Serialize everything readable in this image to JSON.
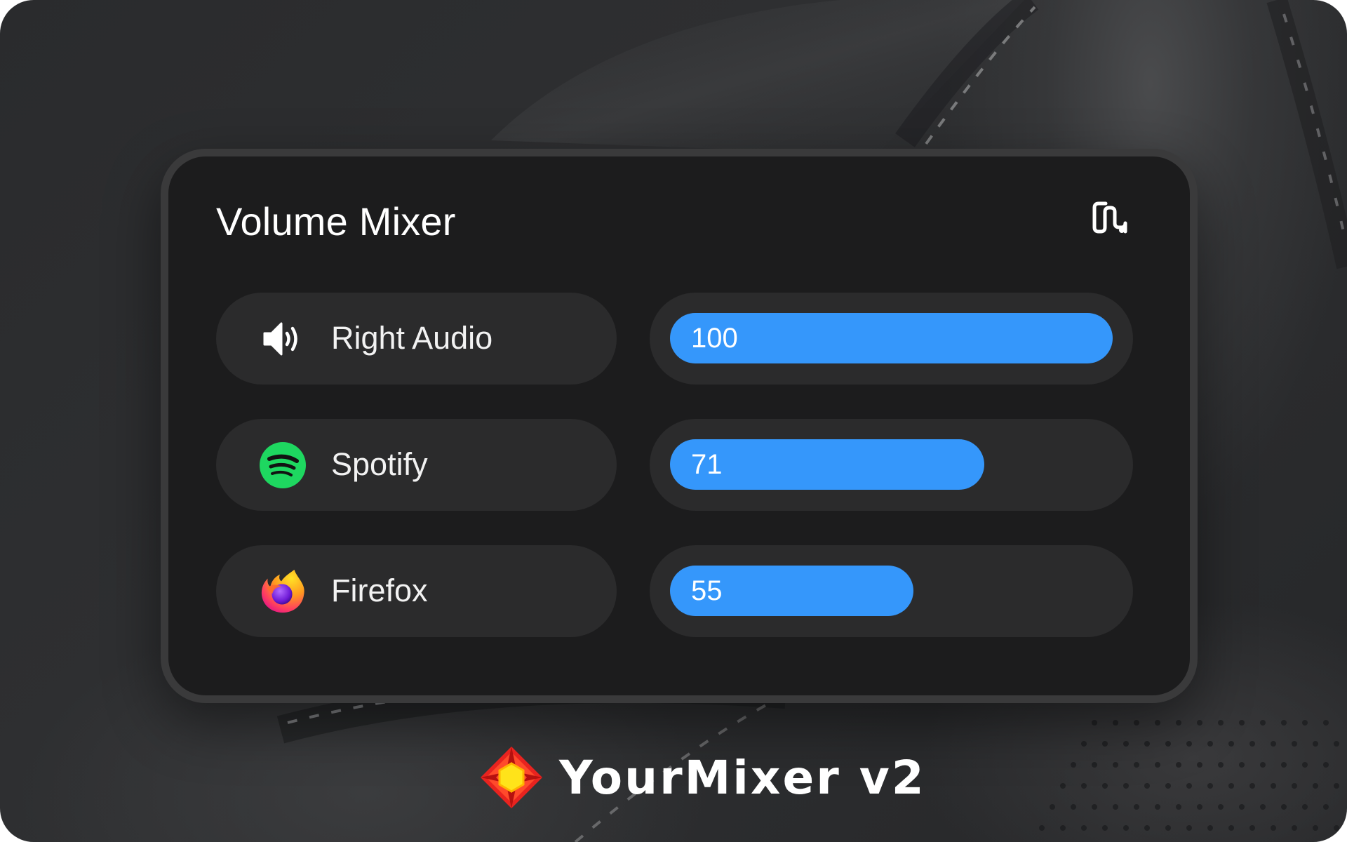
{
  "panel": {
    "title": "Volume Mixer",
    "link_icon": "link-chain-icon"
  },
  "mixer": {
    "channels": [
      {
        "label": "Right Audio",
        "icon": "speaker-icon",
        "value": "100",
        "level": 100
      },
      {
        "label": "Spotify",
        "icon": "spotify-icon",
        "value": "71",
        "level": 71
      },
      {
        "label": "Firefox",
        "icon": "firefox-icon",
        "value": "55",
        "level": 55
      }
    ]
  },
  "brand": {
    "name": "YourMixer v2",
    "logo_icon": "yourmixer-logo-icon"
  },
  "colors": {
    "accent": "#3597fb",
    "panel_bg": "#1c1c1d",
    "pill_bg": "#2b2b2c",
    "panel_border": "#3a3a3b",
    "spotify_green": "#1ed760"
  }
}
